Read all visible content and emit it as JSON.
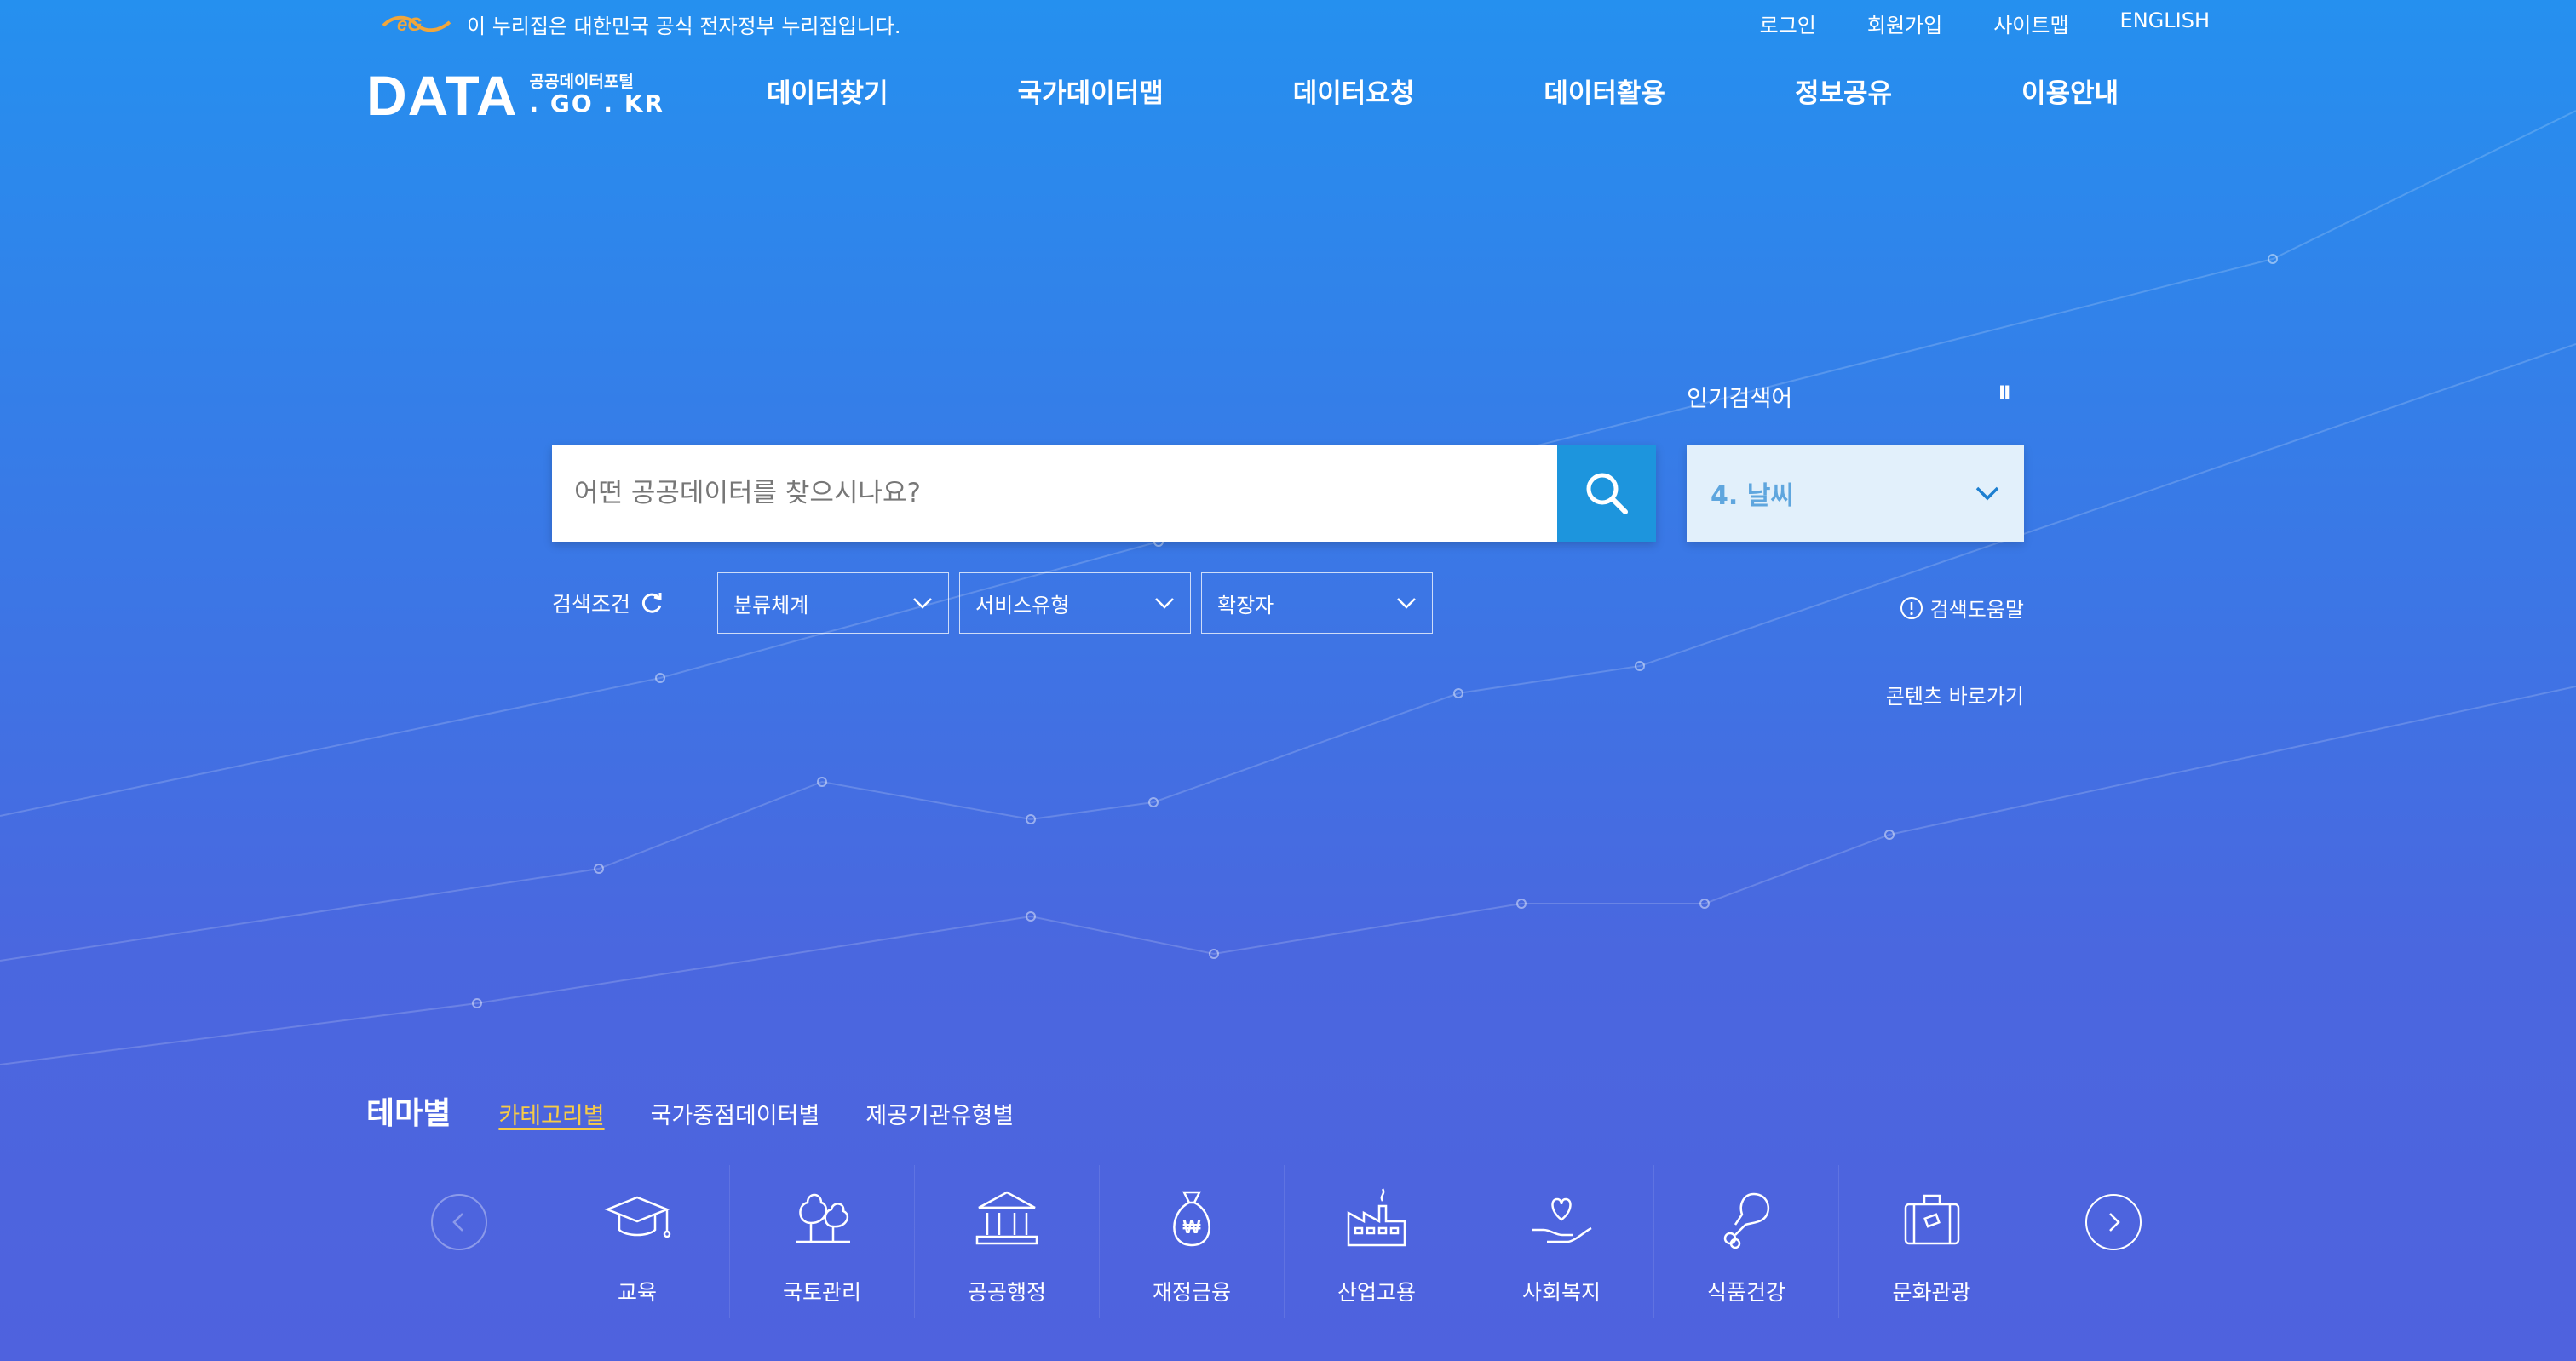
{
  "gov_banner": {
    "text": "이 누리집은 대한민국 공식 전자정부 누리집입니다."
  },
  "util_links": [
    "로그인",
    "회원가입",
    "사이트맵",
    "ENGLISH"
  ],
  "logo": {
    "main": "DATA",
    "sub_korean": "공공데이터포털",
    "sub_domain": ". GO . KR"
  },
  "gnb": [
    "데이터찾기",
    "국가데이터맵",
    "데이터요청",
    "데이터활용",
    "정보공유",
    "이용안내"
  ],
  "search": {
    "placeholder": "어떤 공공데이터를 찾으시나요?",
    "value": ""
  },
  "popular": {
    "label": "인기검색어",
    "pause": "II",
    "current": "4. 날씨"
  },
  "conditions": {
    "label": "검색조건",
    "selects": [
      "분류체계",
      "서비스유형",
      "확장자"
    ]
  },
  "help": {
    "label": "검색도움말"
  },
  "shortcut": {
    "label": "콘텐츠 바로가기"
  },
  "theme": {
    "title": "테마별",
    "tabs": [
      "카테고리별",
      "국가중점데이터별",
      "제공기관유형별"
    ]
  },
  "categories": [
    "교육",
    "국토관리",
    "공공행정",
    "재정금융",
    "산업고용",
    "사회복지",
    "식품건강",
    "문화관광"
  ],
  "colors": {
    "accent": "#1d95dd",
    "tab_active": "#f7cb45",
    "popular_text": "#5fa6de"
  }
}
